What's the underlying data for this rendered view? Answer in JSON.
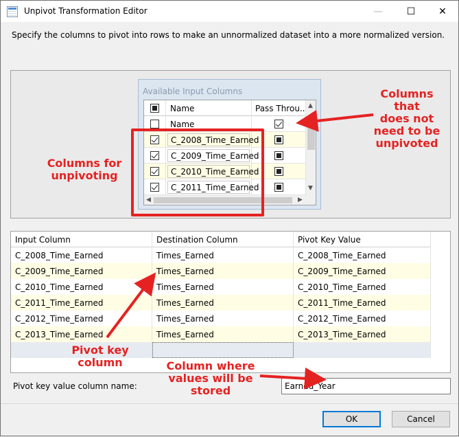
{
  "window": {
    "title": "Unpivot Transformation Editor",
    "minimize_glyph": "—",
    "maximize_glyph": "☐",
    "close_glyph": "✕"
  },
  "description": "Specify the columns to pivot into rows to make an unnormalized dataset into a more normalized version.",
  "available_columns": {
    "title": "Available Input Columns",
    "header": {
      "name": "Name",
      "pass_through": "Pass Throu..."
    },
    "rows": [
      {
        "selected": false,
        "name": "Name",
        "pass_through": true
      },
      {
        "selected": true,
        "name": "C_2008_Time_Earned",
        "pass_through": "indeterminate"
      },
      {
        "selected": true,
        "name": "C_2009_Time_Earned",
        "pass_through": "indeterminate"
      },
      {
        "selected": true,
        "name": "C_2010_Time_Earned",
        "pass_through": "indeterminate"
      },
      {
        "selected": true,
        "name": "C_2011_Time_Earned",
        "pass_through": "indeterminate"
      }
    ]
  },
  "mapping_grid": {
    "headers": [
      "Input Column",
      "Destination Column",
      "Pivot Key Value"
    ],
    "rows": [
      [
        "C_2008_Time_Earned",
        "Times_Earned",
        "C_2008_Time_Earned"
      ],
      [
        "C_2009_Time_Earned",
        "Times_Earned",
        "C_2009_Time_Earned"
      ],
      [
        "C_2010_Time_Earned",
        "Times_Earned",
        "C_2010_Time_Earned"
      ],
      [
        "C_2011_Time_Earned",
        "Times_Earned",
        "C_2011_Time_Earned"
      ],
      [
        "C_2012_Time_Earned",
        "Times_Earned",
        "C_2012_Time_Earned"
      ],
      [
        "C_2013_Time_Earned",
        "Times_Earned",
        "C_2013_Time_Earned"
      ]
    ]
  },
  "pivot_key": {
    "label": "Pivot key value column name:",
    "value": "Earned_Year"
  },
  "buttons": {
    "ok": "OK",
    "cancel": "Cancel"
  },
  "annotations": {
    "columns_not_unpivoted": [
      "Columns that",
      "does not",
      "need to be",
      "unpivoted"
    ],
    "columns_for_unpivoting": [
      "Columns for",
      "unpivoting"
    ],
    "pivot_key_column": "Pivot key column",
    "column_values_stored": [
      "Column where",
      "values will be",
      "stored"
    ],
    "accent_color": "#e52222"
  }
}
